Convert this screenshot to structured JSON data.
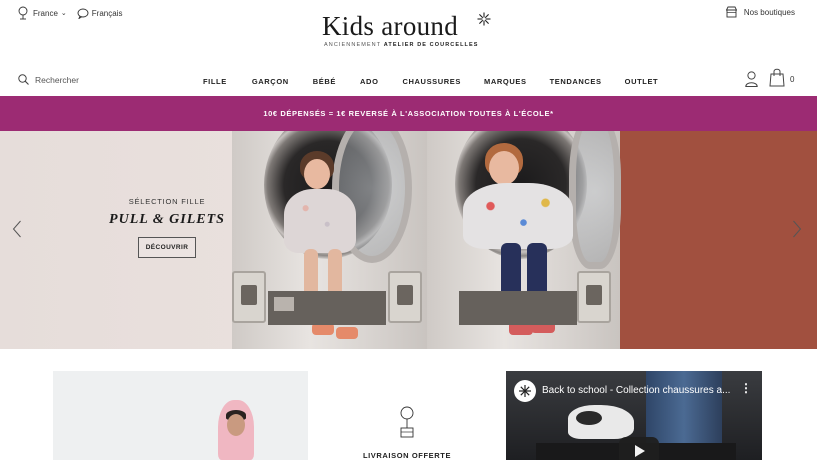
{
  "topbar": {
    "country": "France",
    "language": "Français",
    "stores": "Nos boutiques"
  },
  "logo": {
    "name": "Kids around",
    "sub_prefix": "ANCIENNEMENT",
    "sub_bold": "ATELIER DE COURCELLES"
  },
  "search": {
    "label": "Rechercher"
  },
  "nav": {
    "items": [
      "FILLE",
      "GARÇON",
      "BÉBÉ",
      "ADO",
      "CHAUSSURES",
      "MARQUES",
      "TENDANCES",
      "OUTLET"
    ]
  },
  "cart": {
    "count": "0"
  },
  "promo": {
    "text": "10€ DÉPENSÉS = 1€ REVERSÉ À L'ASSOCIATION TOUTES À L'ÉCOLE*"
  },
  "hero": {
    "kicker": "SÉLECTION FILLE",
    "title": "PULL & GILETS",
    "cta": "DÉCOUVRIR"
  },
  "delivery": {
    "label": "LIVRAISON OFFERTE"
  },
  "video": {
    "title": "Back to school - Collection chaussures a..."
  },
  "colors": {
    "promo_bg": "#9c2b73",
    "brick": "#a1503f"
  }
}
